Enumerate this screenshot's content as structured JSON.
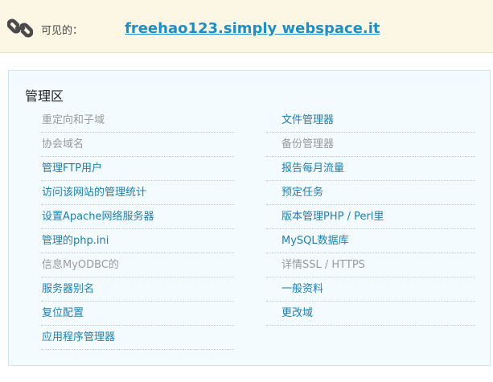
{
  "header": {
    "visible_label": "可见的：",
    "site_url": "freehao123.simply webspace.it",
    "icon": "link-chain-icon"
  },
  "panel": {
    "title": "管理区",
    "left_items": [
      {
        "label": "重定向和子域",
        "enabled": false
      },
      {
        "label": "协会域名",
        "enabled": false
      },
      {
        "label": "管理FTP用户",
        "enabled": true
      },
      {
        "label": "访问该网站的管理统计",
        "enabled": true
      },
      {
        "label": "设置Apache网络服务器",
        "enabled": true
      },
      {
        "label": "管理的php.ini",
        "enabled": true
      },
      {
        "label": "信息MyODBC的",
        "enabled": false
      },
      {
        "label": "服务器别名",
        "enabled": true
      },
      {
        "label": "复位配置",
        "enabled": true
      },
      {
        "label": "应用程序管理器",
        "enabled": true
      }
    ],
    "right_items": [
      {
        "label": "文件管理器",
        "enabled": true
      },
      {
        "label": "备份管理器",
        "enabled": false
      },
      {
        "label": "报告每月流量",
        "enabled": true
      },
      {
        "label": "预定任务",
        "enabled": true
      },
      {
        "label": "版本管理PHP / Perl里",
        "enabled": true
      },
      {
        "label": "MySQL数据库",
        "enabled": true
      },
      {
        "label": "详情SSL / HTTPS",
        "enabled": false
      },
      {
        "label": "一般资料",
        "enabled": true
      },
      {
        "label": "更改域",
        "enabled": true
      }
    ]
  },
  "colors": {
    "link": "#1b7fb3",
    "disabled": "#9a9a9a",
    "url": "#1e8fc6"
  }
}
